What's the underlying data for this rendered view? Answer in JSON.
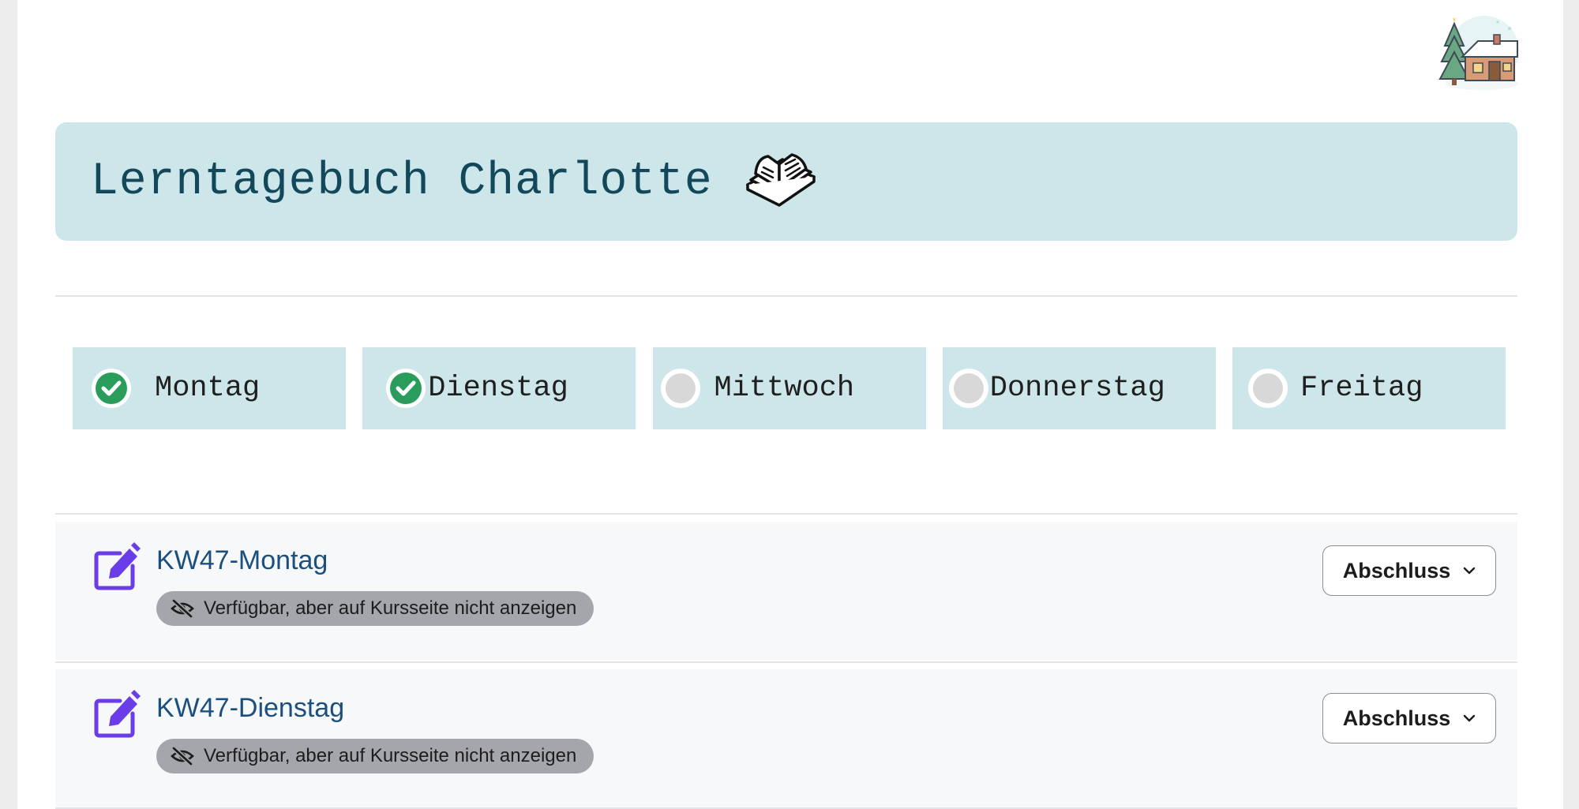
{
  "banner": {
    "title": "Lerntagebuch Charlotte"
  },
  "icons": {
    "avatar": "winter-house-avatar",
    "book": "open-book-icon",
    "check": "check-circle-icon",
    "pending": "empty-circle-icon",
    "edit": "edit-assignment-icon",
    "hidden": "eye-slash-icon",
    "chevron": "chevron-down-icon"
  },
  "colors": {
    "banner_bg": "#cde6ea",
    "check_green": "#2a9d5c",
    "assignment_purple": "#6a3de8",
    "link_blue": "#1b4f7e"
  },
  "days": [
    {
      "label": "Montag",
      "done": true
    },
    {
      "label": "Dienstag",
      "done": true
    },
    {
      "label": "Mittwoch",
      "done": false
    },
    {
      "label": "Donnerstag",
      "done": false
    },
    {
      "label": "Freitag",
      "done": false
    }
  ],
  "activities": [
    {
      "title": "KW47-Montag",
      "badge": "Verfügbar, aber auf Kursseite nicht anzeigen",
      "button": "Abschluss"
    },
    {
      "title": "KW47-Dienstag",
      "badge": "Verfügbar, aber auf Kursseite nicht anzeigen",
      "button": "Abschluss"
    }
  ]
}
